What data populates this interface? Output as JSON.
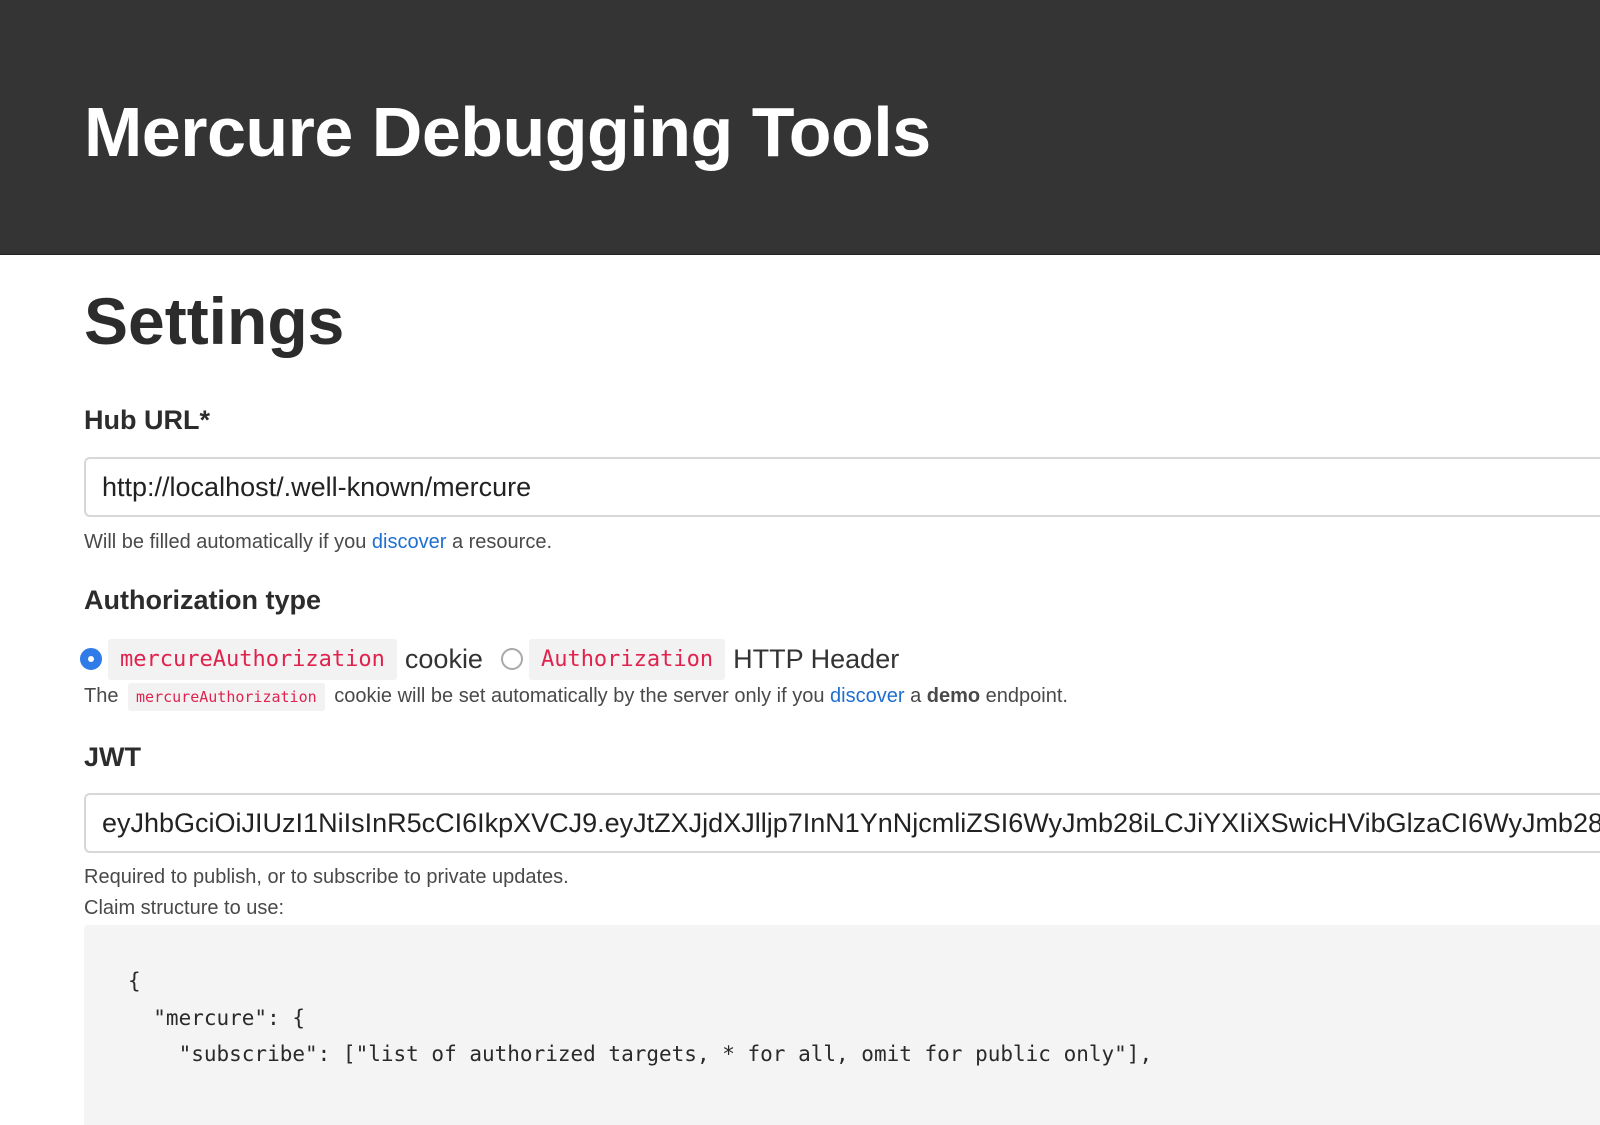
{
  "header": {
    "title": "Mercure Debugging Tools"
  },
  "settings": {
    "title": "Settings",
    "hub_url": {
      "label": "Hub URL*",
      "value": "http://localhost/.well-known/mercure",
      "help_prefix": "Will be filled automatically if you",
      "help_link": "discover",
      "help_suffix": "a resource."
    },
    "authorization": {
      "label": "Authorization type",
      "options": [
        {
          "code": "mercureAuthorization",
          "text": "cookie",
          "selected": true
        },
        {
          "code": "Authorization",
          "text": "HTTP Header",
          "selected": false
        }
      ],
      "help_prefix": "The",
      "help_code": "mercureAuthorization",
      "help_middle": "cookie will be set automatically by the server only if you",
      "help_link": "discover",
      "help_a": "a",
      "help_bold": "demo",
      "help_suffix": "endpoint."
    },
    "jwt": {
      "label": "JWT",
      "value": "eyJhbGciOiJIUzI1NiIsInR5cCI6IkpXVCJ9.eyJtZXJjdXJlljp7InN1YnNjcmliZSI6WyJmb28iLCJiYXIiXSwicHVibGlzaCI6WyJmb28",
      "help_line1": "Required to publish, or to subscribe to private updates.",
      "help_line2": "Claim structure to use:",
      "claim_structure": "{\n  \"mercure\": {\n    \"subscribe\": [\"list of authorized targets, * for all, omit for public only\"],"
    }
  },
  "colors": {
    "header_bg": "#343434",
    "link": "#1f6fd1",
    "code_text": "#e0234e",
    "radio_selected": "#2f7be8"
  }
}
